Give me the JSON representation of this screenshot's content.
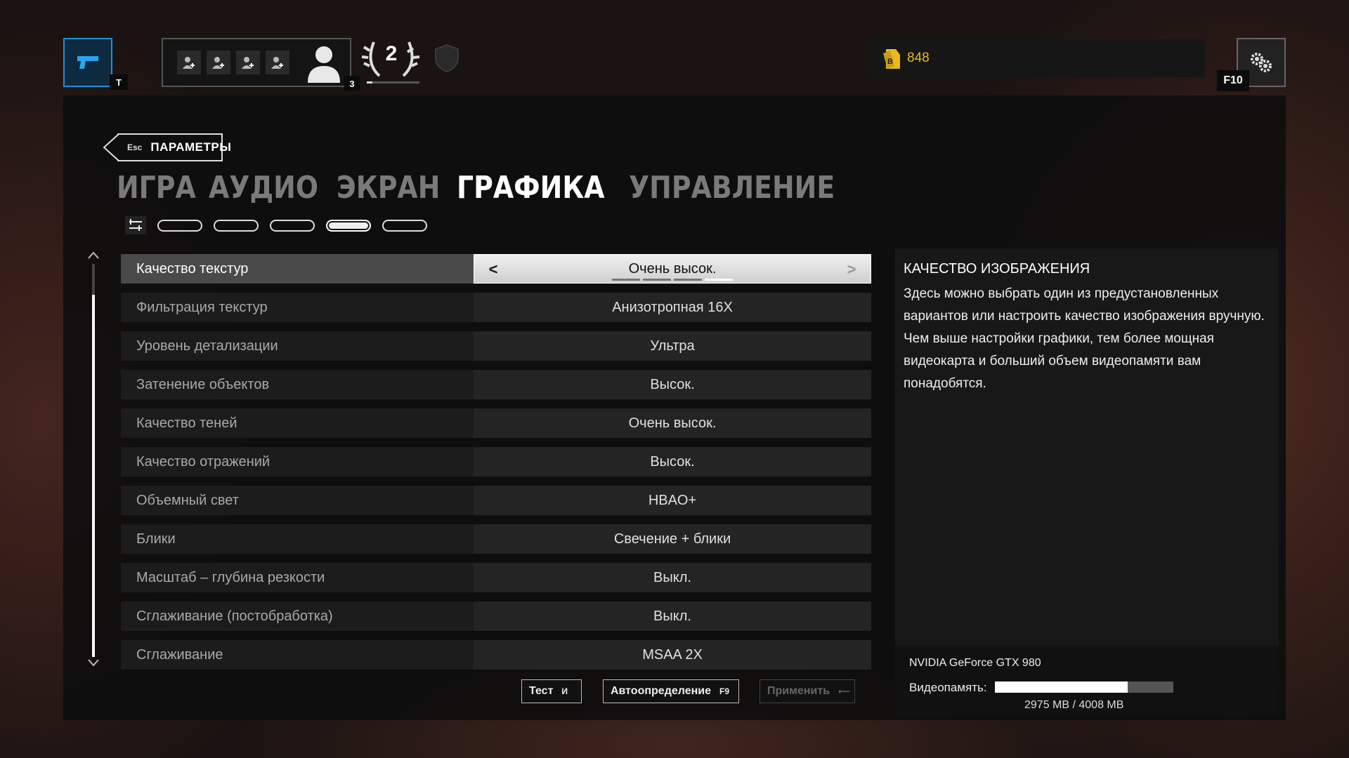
{
  "topbar": {
    "weapon_key": "T",
    "party_level": "3",
    "rank_number": "2",
    "rank_progress": 0.1,
    "currency_value": "848",
    "settings_key": "F10",
    "colors": {
      "accent_blue": "#1f8fd6",
      "currency_gold": "#e8b920"
    }
  },
  "header": {
    "back_key": "Esc",
    "back_label": "ПАРАМЕТРЫ",
    "tabs": [
      {
        "label": "ИГРА",
        "active": false
      },
      {
        "label": "АУДИО",
        "active": false
      },
      {
        "label": "ЭКРАН",
        "active": false
      },
      {
        "label": "ГРАФИКА",
        "active": true
      },
      {
        "label": "УПРАВЛЕНИЕ",
        "active": false
      }
    ],
    "subtabs_active_index": 3,
    "subtabs_count": 5
  },
  "settings": [
    {
      "label": "Качество текстур",
      "value": "Очень высок.",
      "selected": true,
      "level": 4,
      "levels": 4
    },
    {
      "label": "Фильтрация текстур",
      "value": "Анизотропная 16X"
    },
    {
      "label": "Уровень детализации",
      "value": "Ультра"
    },
    {
      "label": "Затенение объектов",
      "value": "Высок."
    },
    {
      "label": "Качество теней",
      "value": "Очень высок."
    },
    {
      "label": "Качество отражений",
      "value": "Высок."
    },
    {
      "label": "Объемный свет",
      "value": "HBAO+"
    },
    {
      "label": "Блики",
      "value": "Свечение + блики"
    },
    {
      "label": "Масштаб – глубина резкости",
      "value": "Выкл."
    },
    {
      "label": "Сглаживание (постобработка)",
      "value": "Выкл."
    },
    {
      "label": "Сглаживание",
      "value": "MSAA 2X"
    }
  ],
  "buttons": {
    "test": {
      "label": "Тест",
      "key": "И"
    },
    "auto": {
      "label": "Автоопределение",
      "key": "F9"
    },
    "apply": {
      "label": "Применить",
      "key": "⟵"
    }
  },
  "info": {
    "title": "КАЧЕСТВО ИЗОБРАЖЕНИЯ",
    "text": "Здесь можно выбрать один из предустановленных вариантов или настроить качество изображения вручную. Чем выше настройки графики, тем более мощная видеокарта и больший объем видеопамяти вам понадобятся."
  },
  "gpu": {
    "name": "NVIDIA GeForce GTX 980",
    "vram_label": "Видеопамять:",
    "vram_text": "2975 MB / 4008 MB",
    "vram_used": 2975,
    "vram_total": 4008
  }
}
